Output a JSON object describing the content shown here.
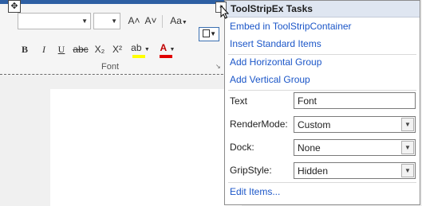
{
  "ribbon": {
    "grow_font": "A˄",
    "shrink_font": "A˅",
    "change_case": "Aa",
    "bold": "B",
    "italic": "I",
    "underline": "U",
    "strikethrough": "abc",
    "subscript": "X₂",
    "superscript": "X²",
    "highlight": "ab",
    "font_color": "A",
    "group_label": "Font",
    "highlight_color": "#ffff00",
    "font_color_value": "#e00000"
  },
  "smart_tag": {
    "title": "ToolStripEx Tasks",
    "actions": {
      "embed": "Embed in ToolStripContainer",
      "insert": "Insert Standard Items",
      "add_horizontal": "Add Horizontal Group",
      "add_vertical": "Add Vertical Group",
      "edit_items": "Edit Items..."
    },
    "properties": {
      "text_label": "Text",
      "text_value": "Font",
      "render_label": "RenderMode:",
      "render_value": "Custom",
      "dock_label": "Dock:",
      "dock_value": "None",
      "grip_label": "GripStyle:",
      "grip_value": "Hidden"
    }
  },
  "colors": {
    "link": "#1b56c8",
    "header_bg": "#dfe6f1",
    "accent_strip": "#2d5fa3"
  }
}
